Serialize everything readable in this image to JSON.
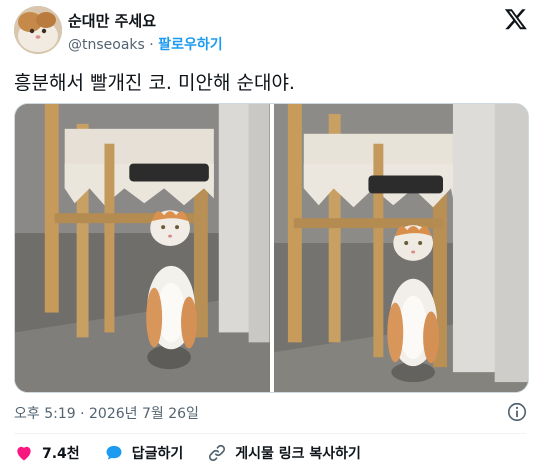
{
  "author": {
    "display_name": "순대만 주세요",
    "handle": "@tnseoaks",
    "separator": "·",
    "follow_label": "팔로우하기"
  },
  "tweet": {
    "text": "흥분해서 빨개진 코. 미안해 순대야.",
    "timestamp": "오후 5:19 · 2026년 7월 26일"
  },
  "actions": {
    "like_count": "7.4천",
    "reply_label": "답글하기",
    "copy_link_label": "게시물 링크 복사하기"
  },
  "colors": {
    "accent": "#1d9bf0",
    "like": "#f91880",
    "text": "#0f1419",
    "secondary": "#536471"
  },
  "icons": {
    "logo": "x-logo-icon",
    "info": "info-icon",
    "like": "heart-icon",
    "reply": "speech-bubble-icon",
    "copy_link": "link-icon"
  },
  "media": {
    "image_count": 2
  }
}
